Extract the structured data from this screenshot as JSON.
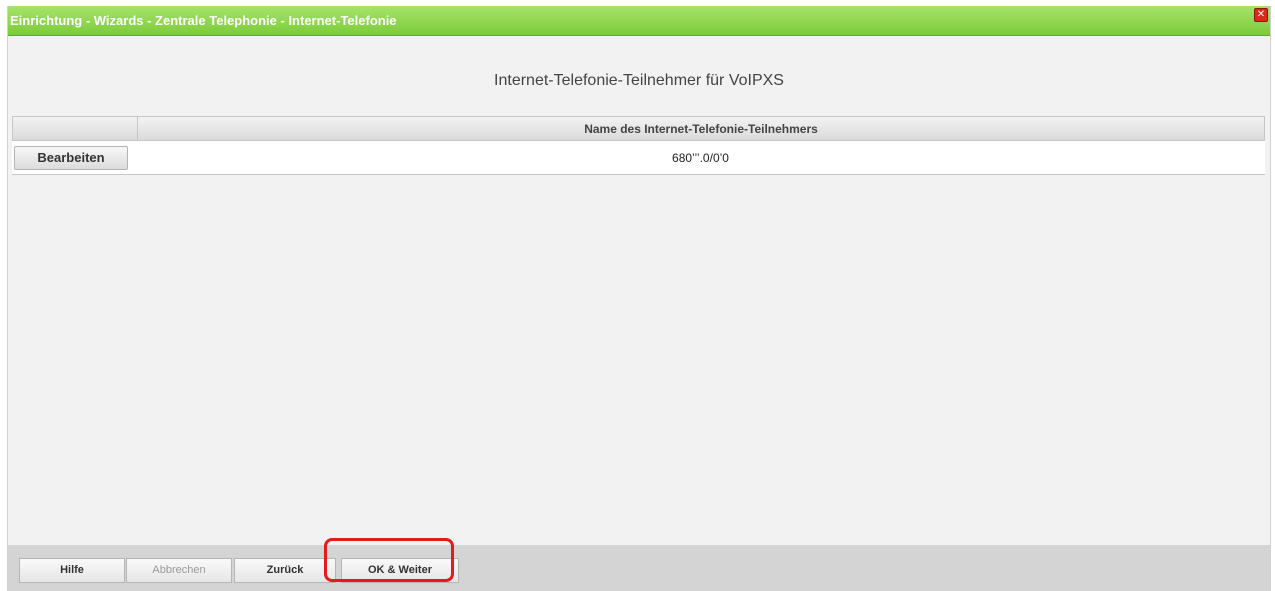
{
  "window": {
    "title": "Einrichtung - Wizards - Zentrale Telephonie - Internet-Telefonie",
    "close_glyph": "✕"
  },
  "main": {
    "heading": "Internet-Telefonie-Teilnehmer für VoIPXS",
    "table": {
      "columns": [
        "",
        "Name des Internet-Telefonie-Teilnehmers"
      ],
      "rows": [
        {
          "action_label": "Bearbeiten",
          "name": "680’’’.0/0’0"
        }
      ]
    }
  },
  "footer": {
    "help_label": "Hilfe",
    "cancel_label": "Abbrechen",
    "back_label": "Zurück",
    "ok_next_label": "OK & Weiter"
  },
  "colors": {
    "titlebar": "#8bd648",
    "highlight": "#e51a1a"
  }
}
